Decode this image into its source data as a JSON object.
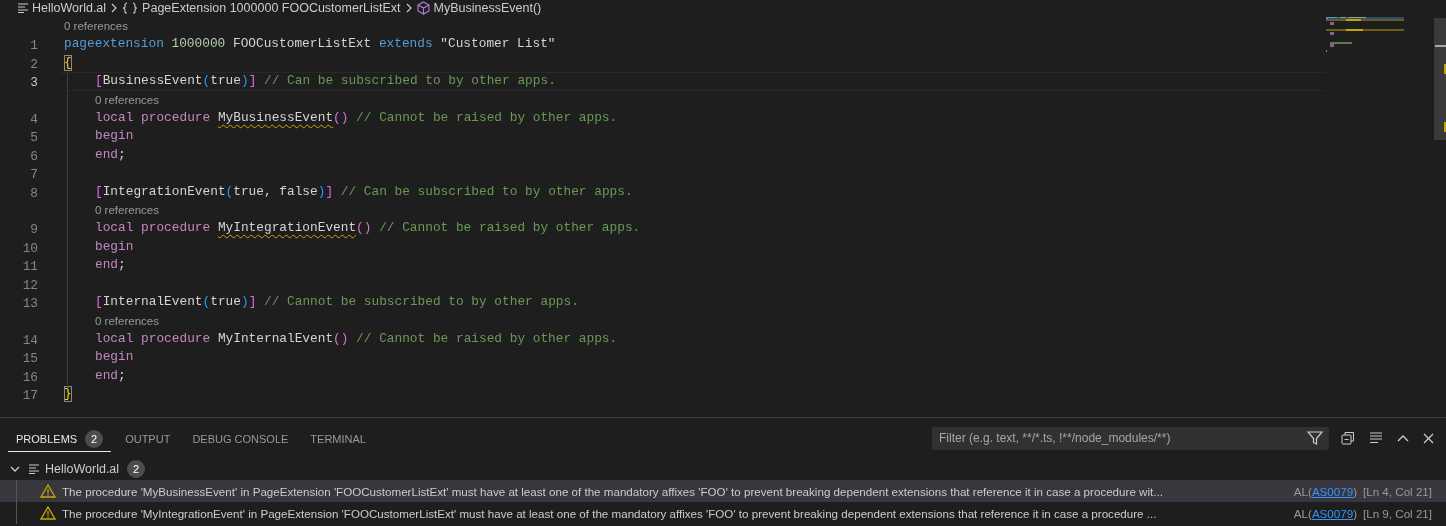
{
  "breadcrumbs": [
    {
      "kind": "file",
      "label": "HelloWorld.al"
    },
    {
      "kind": "namespace",
      "label": "PageExtension 1000000 FOOCustomerListExt"
    },
    {
      "kind": "method",
      "label": "MyBusinessEvent()"
    }
  ],
  "editor": {
    "lines": [
      {
        "kind": "lens",
        "text": "0 references"
      },
      {
        "kind": "code",
        "number": "1",
        "current": false,
        "tokens": [
          {
            "kind": "keyword",
            "text": "pageextension "
          },
          {
            "kind": "number",
            "text": "1000000 "
          },
          {
            "kind": "plain",
            "text": "FOOCustomerListExt "
          },
          {
            "kind": "keyword",
            "text": "extends "
          },
          {
            "kind": "plain",
            "text": "\"Customer List\""
          }
        ]
      },
      {
        "kind": "code",
        "number": "2",
        "current": false,
        "tokens": [
          {
            "kind": "brace",
            "text": "{",
            "matched": true
          }
        ],
        "children": [
          {
            "kind": "code",
            "number": "3",
            "current": true,
            "tokens": [
              {
                "kind": "bracket2",
                "text": "["
              },
              {
                "kind": "plain",
                "text": "BusinessEvent"
              },
              {
                "kind": "bracket3",
                "text": "("
              },
              {
                "kind": "plain",
                "text": "true"
              },
              {
                "kind": "bracket3",
                "text": ")"
              },
              {
                "kind": "bracket2",
                "text": "]"
              },
              {
                "kind": "comment",
                "text": " // Can be subscribed to by other apps."
              }
            ]
          },
          {
            "kind": "lens",
            "text": "0 references"
          },
          {
            "kind": "code",
            "number": "4",
            "current": false,
            "tokens": [
              {
                "kind": "control",
                "text": "local procedure "
              },
              {
                "kind": "plain",
                "text": "MyBusinessEvent",
                "squiggle": true
              },
              {
                "kind": "bracket2",
                "text": "()"
              },
              {
                "kind": "comment",
                "text": " // Cannot be raised by other apps."
              }
            ]
          },
          {
            "kind": "code",
            "number": "5",
            "current": false,
            "tokens": [
              {
                "kind": "control",
                "text": "begin"
              }
            ]
          },
          {
            "kind": "code",
            "number": "6",
            "current": false,
            "tokens": [
              {
                "kind": "control",
                "text": "end"
              },
              {
                "kind": "plain",
                "text": ";"
              }
            ]
          },
          {
            "kind": "code",
            "number": "7",
            "current": false
          },
          {
            "kind": "code",
            "number": "8",
            "current": false,
            "tokens": [
              {
                "kind": "bracket2",
                "text": "["
              },
              {
                "kind": "plain",
                "text": "IntegrationEvent"
              },
              {
                "kind": "bracket3",
                "text": "("
              },
              {
                "kind": "plain",
                "text": "true, false"
              },
              {
                "kind": "bracket3",
                "text": ")"
              },
              {
                "kind": "bracket2",
                "text": "]"
              },
              {
                "kind": "comment",
                "text": " // Can be subscribed to by other apps."
              }
            ]
          },
          {
            "kind": "lens",
            "text": "0 references"
          },
          {
            "kind": "code",
            "number": "9",
            "current": false,
            "tokens": [
              {
                "kind": "control",
                "text": "local procedure "
              },
              {
                "kind": "plain",
                "text": "MyIntegrationEvent",
                "squiggle": true
              },
              {
                "kind": "bracket2",
                "text": "()"
              },
              {
                "kind": "comment",
                "text": " // Cannot be raised by other apps."
              }
            ]
          },
          {
            "kind": "code",
            "number": "10",
            "current": false,
            "tokens": [
              {
                "kind": "control",
                "text": "begin"
              }
            ]
          },
          {
            "kind": "code",
            "number": "11",
            "current": false,
            "tokens": [
              {
                "kind": "control",
                "text": "end"
              },
              {
                "kind": "plain",
                "text": ";"
              }
            ]
          },
          {
            "kind": "code",
            "number": "12",
            "current": false
          },
          {
            "kind": "code",
            "number": "13",
            "current": false,
            "tokens": [
              {
                "kind": "bracket2",
                "text": "["
              },
              {
                "kind": "plain",
                "text": "InternalEvent"
              },
              {
                "kind": "bracket3",
                "text": "("
              },
              {
                "kind": "plain",
                "text": "true"
              },
              {
                "kind": "bracket3",
                "text": ")"
              },
              {
                "kind": "bracket2",
                "text": "]"
              },
              {
                "kind": "comment",
                "text": " // Cannot be subscribed to by other apps."
              }
            ]
          },
          {
            "kind": "lens",
            "text": "0 references"
          },
          {
            "kind": "code",
            "number": "14",
            "current": false,
            "tokens": [
              {
                "kind": "control",
                "text": "local procedure "
              },
              {
                "kind": "plain",
                "text": "MyInternalEvent"
              },
              {
                "kind": "bracket2",
                "text": "()"
              },
              {
                "kind": "comment",
                "text": " // Cannot be raised by other apps."
              }
            ]
          },
          {
            "kind": "code",
            "number": "15",
            "current": false,
            "tokens": [
              {
                "kind": "control",
                "text": "begin"
              }
            ]
          },
          {
            "kind": "code",
            "number": "16",
            "current": false,
            "tokens": [
              {
                "kind": "control",
                "text": "end"
              },
              {
                "kind": "plain",
                "text": ";"
              }
            ]
          }
        ]
      },
      {
        "kind": "code",
        "number": "17",
        "current": false,
        "tokens": [
          {
            "kind": "brace",
            "text": "}",
            "matched": true
          }
        ]
      }
    ]
  },
  "panel": {
    "tabs": [
      {
        "label": "PROBLEMS",
        "badge": "2",
        "selected": true
      },
      {
        "label": "OUTPUT",
        "selected": false
      },
      {
        "label": "DEBUG CONSOLE",
        "selected": false
      },
      {
        "label": "TERMINAL",
        "selected": false
      }
    ],
    "filter": {
      "placeholder": "Filter (e.g. text, **/*.ts, !**/node_modules/**)"
    },
    "groups": [
      {
        "file": "HelloWorld.al",
        "count": "2",
        "expanded": true,
        "problems": [
          {
            "message": "The procedure 'MyBusinessEvent' in PageExtension 'FOOCustomerListExt' must have at least one of the mandatory affixes 'FOO' to prevent breaking dependent extensions that reference it in case a procedure wit...",
            "source_prefix": "AL(",
            "code": "AS0079",
            "source_suffix": ")",
            "location": "[Ln 4, Col 21]",
            "selected": true
          },
          {
            "message": "The procedure 'MyIntegrationEvent' in PageExtension 'FOOCustomerListExt' must have at least one of the mandatory affixes 'FOO' to prevent breaking dependent extensions that reference it in case a procedure ...",
            "source_prefix": "AL(",
            "code": "AS0079",
            "source_suffix": ")",
            "location": "[Ln 9, Col 21]",
            "selected": false
          }
        ]
      }
    ]
  }
}
